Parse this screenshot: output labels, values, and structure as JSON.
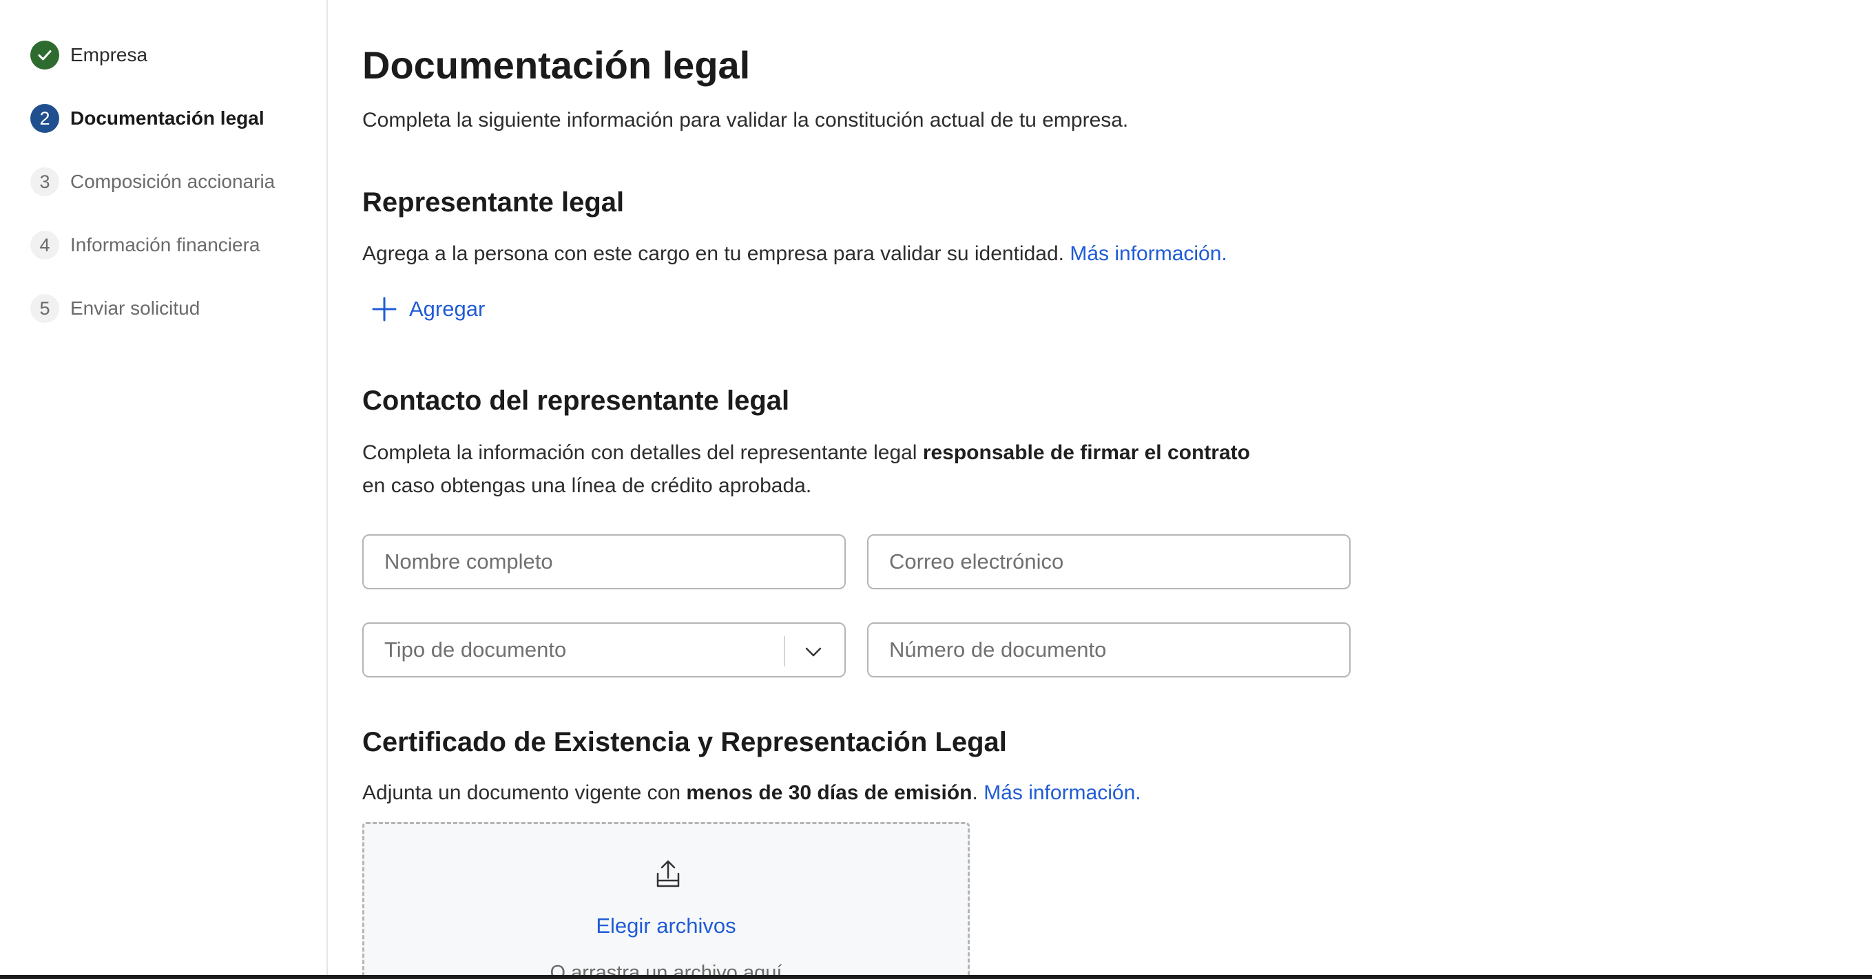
{
  "sidebar": {
    "steps": [
      {
        "label": "Empresa",
        "status": "done"
      },
      {
        "number": "2",
        "label": "Documentación legal",
        "status": "current"
      },
      {
        "number": "3",
        "label": "Composición accionaria",
        "status": "pending"
      },
      {
        "number": "4",
        "label": "Información financiera",
        "status": "pending"
      },
      {
        "number": "5",
        "label": "Enviar solicitud",
        "status": "pending"
      }
    ]
  },
  "page": {
    "title": "Documentación legal",
    "subtitle": "Completa la siguiente información para validar la constitución actual de tu empresa."
  },
  "representante": {
    "title": "Representante legal",
    "text": "Agrega a la persona con este cargo en tu empresa para validar su identidad.",
    "link": "Más información.",
    "add_label": "Agregar"
  },
  "contacto": {
    "title": "Contacto del representante legal",
    "text_pre": "Completa la información con detalles del representante legal ",
    "text_bold": "responsable de firmar el contrato",
    "text_line2": "en caso obtengas una línea de crédito aprobada.",
    "fields": {
      "nombre_placeholder": "Nombre completo",
      "correo_placeholder": "Correo electrónico",
      "tipo_placeholder": "Tipo de documento",
      "numero_placeholder": "Número de documento"
    }
  },
  "certificado": {
    "title": "Certificado de Existencia y Representación Legal",
    "text_pre": "Adjunta un documento vigente con ",
    "text_bold": "menos de 30 días de emisión",
    "text_post": ".",
    "link": "Más información.",
    "choose_label": "Elegir archivos",
    "drag_label": "O arrastra un archivo aquí"
  },
  "colors": {
    "accent": "#1f5bd6",
    "done": "#2e6b2f",
    "current": "#1f4f8e"
  },
  "icons": [
    "check-icon",
    "plus-icon",
    "chevron-down-icon",
    "upload-icon"
  ]
}
